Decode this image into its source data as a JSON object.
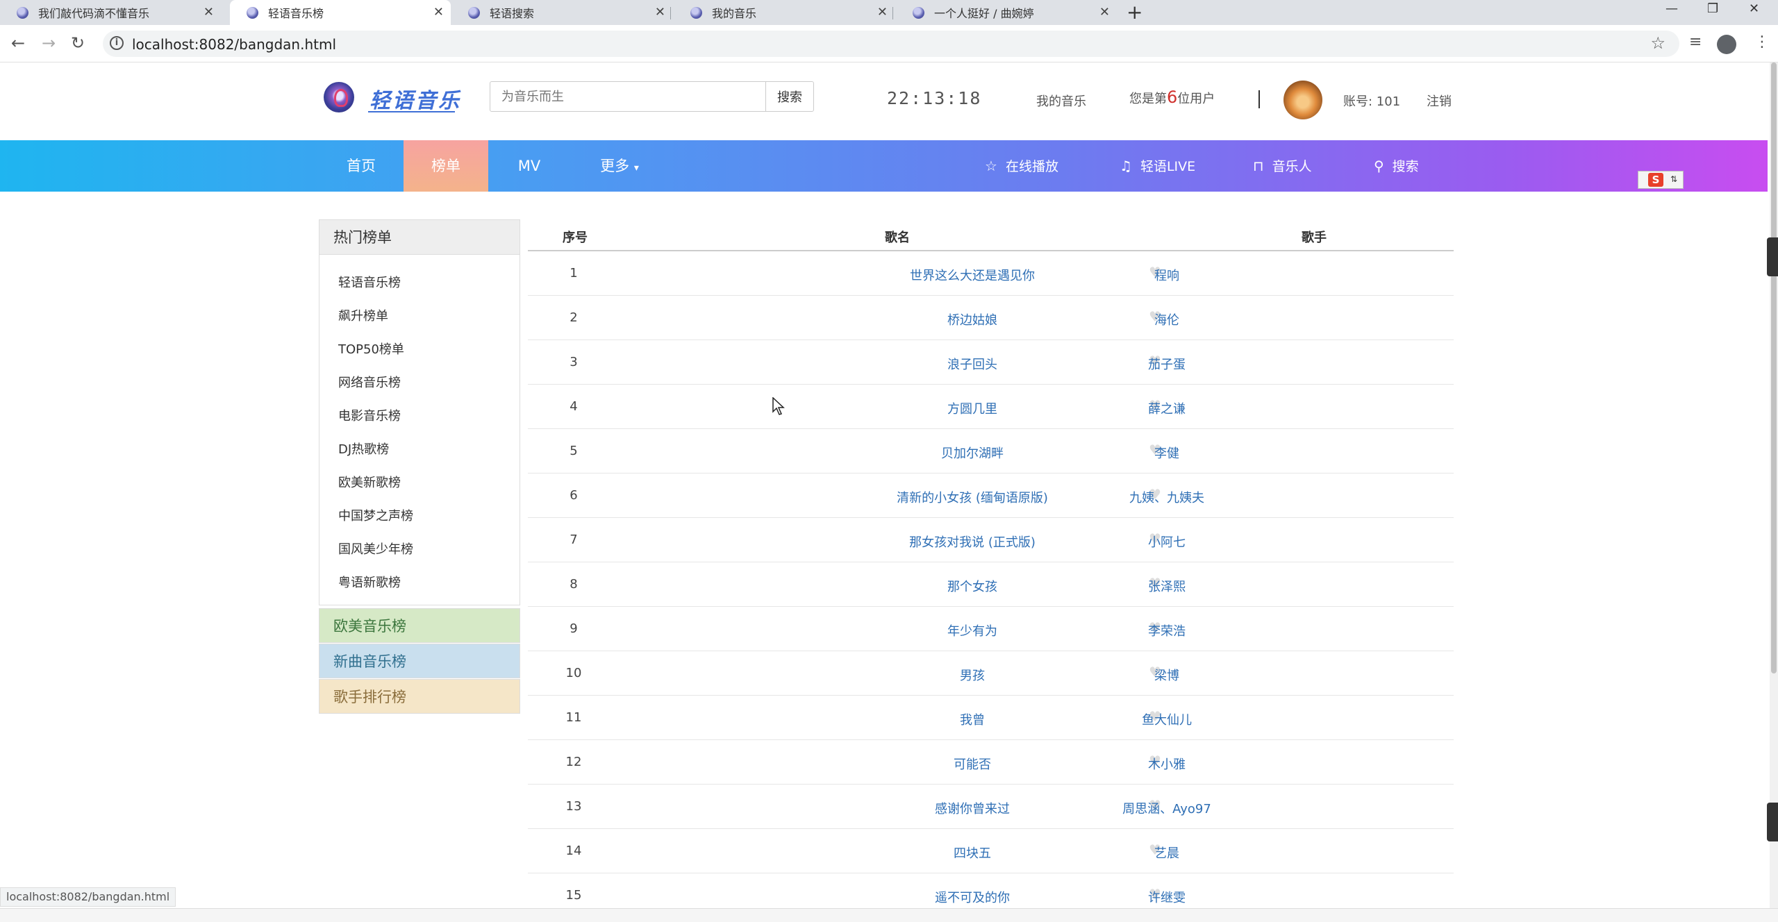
{
  "browser": {
    "tabs": [
      {
        "title": "我们敲代码滴不懂音乐",
        "active": false
      },
      {
        "title": "轻语音乐榜",
        "active": true
      },
      {
        "title": "轻语搜索",
        "active": false
      },
      {
        "title": "我的音乐",
        "active": false
      },
      {
        "title": "一个人挺好 / 曲婉婷",
        "active": false
      }
    ],
    "url": "localhost:8082/bangdan.html",
    "status_url": "localhost:8082/bangdan.html"
  },
  "header": {
    "logo_text": "轻语音乐",
    "search_placeholder": "为音乐而生",
    "search_button": "搜索",
    "clock": "22:13:18",
    "my_music": "我的音乐",
    "user_count_prefix": "您是第",
    "user_count_number": "6",
    "user_count_suffix": "位用户",
    "separator": "|",
    "account": "账号: 101",
    "logout": "注销"
  },
  "nav": {
    "items": [
      {
        "label": "首页",
        "active": false
      },
      {
        "label": "榜单",
        "active": true
      },
      {
        "label": "MV",
        "active": false
      },
      {
        "label": "更多",
        "active": false
      }
    ],
    "more_caret": "▾",
    "right_items": [
      {
        "icon": "star-icon",
        "label": "在线播放"
      },
      {
        "icon": "music-note-icon",
        "label": "轻语LIVE"
      },
      {
        "icon": "headphones-icon",
        "label": "音乐人"
      },
      {
        "icon": "search-icon",
        "label": "搜索"
      }
    ]
  },
  "sidebar": {
    "title": "热门榜单",
    "items": [
      "轻语音乐榜",
      "飙升榜单",
      "TOP50榜单",
      "网络音乐榜",
      "电影音乐榜",
      "DJ热歌榜",
      "欧美新歌榜",
      "中国梦之声榜",
      "国风美少年榜",
      "粤语新歌榜"
    ],
    "extra_panels": [
      {
        "label": "欧美音乐榜",
        "bg": "#d6e9c6",
        "color": "#3c763d"
      },
      {
        "label": "新曲音乐榜",
        "bg": "#c9dfee",
        "color": "#31708f"
      },
      {
        "label": "歌手排行榜",
        "bg": "#f5e6c8",
        "color": "#8a6d3b"
      }
    ]
  },
  "table": {
    "headers": {
      "index": "序号",
      "song": "歌名",
      "artist": "歌手"
    },
    "rows": [
      {
        "index": "1",
        "song": "世界这么大还是遇见你",
        "artist": "程响"
      },
      {
        "index": "2",
        "song": "桥边姑娘",
        "artist": "海伦"
      },
      {
        "index": "3",
        "song": "浪子回头",
        "artist": "茄子蛋"
      },
      {
        "index": "4",
        "song": "方圆几里",
        "artist": "薛之谦"
      },
      {
        "index": "5",
        "song": "贝加尔湖畔",
        "artist": "李健"
      },
      {
        "index": "6",
        "song": "清新的小女孩 (缅甸语原版)",
        "artist": "九姨、九姨夫"
      },
      {
        "index": "7",
        "song": "那女孩对我说 (正式版)",
        "artist": "小阿七"
      },
      {
        "index": "8",
        "song": "那个女孩",
        "artist": "张泽熙"
      },
      {
        "index": "9",
        "song": "年少有为",
        "artist": "李荣浩"
      },
      {
        "index": "10",
        "song": "男孩",
        "artist": "梁博"
      },
      {
        "index": "11",
        "song": "我曾",
        "artist": "鱼大仙儿"
      },
      {
        "index": "12",
        "song": "可能否",
        "artist": "木小雅"
      },
      {
        "index": "13",
        "song": "感谢你曾来过",
        "artist": "周思涵、Ayo97"
      },
      {
        "index": "14",
        "song": "四块五",
        "artist": "艺晨"
      },
      {
        "index": "15",
        "song": "遥不可及的你",
        "artist": "许继雯"
      }
    ]
  }
}
